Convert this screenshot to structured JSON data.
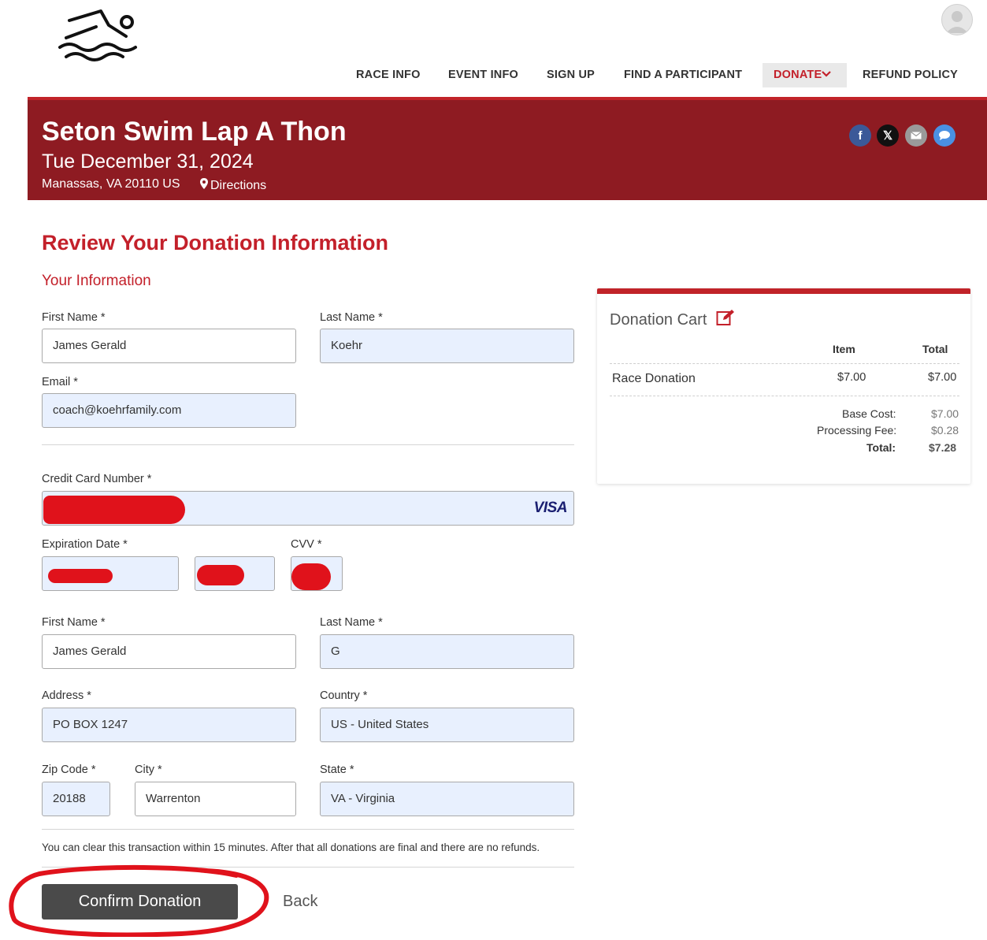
{
  "nav": {
    "race_info": "RACE INFO",
    "event_info": "EVENT INFO",
    "sign_up": "SIGN UP",
    "find_participant": "FIND A PARTICIPANT",
    "donate": "DONATE",
    "refund_policy": "REFUND POLICY"
  },
  "event": {
    "title": "Seton Swim Lap A Thon",
    "date": "Tue December 31, 2024",
    "location": "Manassas, VA 20110 US",
    "directions": "Directions"
  },
  "social": [
    "facebook-icon",
    "x-icon",
    "email-icon",
    "chat-icon"
  ],
  "page": {
    "heading": "Review Your Donation Information",
    "subheading": "Your Information"
  },
  "form": {
    "first_name_label": "First Name *",
    "first_name": "James Gerald",
    "last_name_label": "Last Name *",
    "last_name": "Koehr",
    "email_label": "Email *",
    "email": "coach@koehrfamily.com",
    "cc_label": "Credit Card Number *",
    "card_brand": "VISA",
    "exp_label": "Expiration Date *",
    "cvv_label": "CVV *",
    "bill_first_label": "First Name *",
    "bill_first": "James Gerald",
    "bill_last_label": "Last Name *",
    "bill_last": "G",
    "address_label": "Address *",
    "address": "PO BOX 1247",
    "country_label": "Country *",
    "country": "US - United States",
    "zip_label": "Zip Code *",
    "zip": "20188",
    "city_label": "City *",
    "city": "Warrenton",
    "state_label": "State *",
    "state": "VA - Virginia"
  },
  "notice": "You can clear this transaction within 15 minutes. After that all donations are final and there are no refunds.",
  "actions": {
    "confirm": "Confirm Donation",
    "back": "Back"
  },
  "cart": {
    "title": "Donation Cart",
    "col_item": "Item",
    "col_total": "Total",
    "row_name": "Race Donation",
    "row_item": "$7.00",
    "row_total": "$7.00",
    "base_cost_label": "Base Cost:",
    "base_cost": "$7.00",
    "fee_label": "Processing Fee:",
    "fee": "$0.28",
    "total_label": "Total:",
    "total": "$7.28"
  },
  "colors": {
    "brand_red": "#c3202a",
    "banner": "#8e1b22",
    "button": "#4a4a4a"
  }
}
